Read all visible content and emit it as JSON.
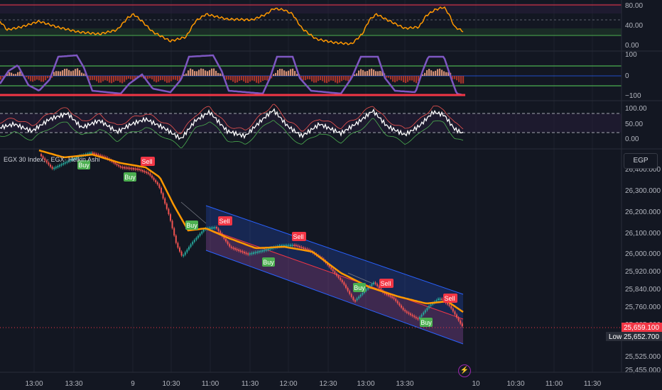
{
  "header": {
    "title": "EGX 30 Index, ",
    "title_tail": "· EGX· Heikin Ashi",
    "currency": "EGP"
  },
  "colors": {
    "background": "#131722",
    "grid": "#1e222d",
    "rsi_line": "#ff9800",
    "osc_line": "#7e57c2",
    "bull": "#26a69a",
    "bear": "#ef5350",
    "buy": "#4caf50",
    "sell": "#f23645",
    "ema": "#ff9800",
    "price_tag": "#f23645",
    "low_tag": "#2a2e39"
  },
  "indicators": {
    "pane1": {
      "ticks": [
        "80.00",
        "40.00",
        "0.00"
      ]
    },
    "pane2": {
      "ticks": [
        "100",
        "0",
        "−100"
      ]
    },
    "pane3": {
      "ticks": [
        "100.00",
        "50.00",
        "0.00"
      ]
    }
  },
  "price_axis": {
    "ticks": [
      "26,400.000",
      "26,300.000",
      "26,200.000",
      "26,100.000",
      "26,000.000",
      "25,920.000",
      "25,840.000",
      "25,760.000",
      "25,685.000",
      "25,525.000",
      "25,455.000"
    ]
  },
  "time_axis": {
    "ticks": [
      "13:00",
      "13:30",
      "9",
      "10:30",
      "11:00",
      "11:30",
      "12:00",
      "12:30",
      "13:00",
      "13:30",
      "10",
      "10:30",
      "11:00",
      "11:30"
    ]
  },
  "price_tags": {
    "last": "25,659.100",
    "low_label": "Low",
    "low_value": "25,652.700"
  },
  "signals": [
    {
      "label": "Buy"
    },
    {
      "label": "Buy"
    },
    {
      "label": "Sell"
    },
    {
      "label": "Buy"
    },
    {
      "label": "Sell"
    },
    {
      "label": "Buy"
    },
    {
      "label": "Sell"
    },
    {
      "label": "Buy"
    },
    {
      "label": "Sell"
    },
    {
      "label": "Buy"
    },
    {
      "label": "Sell"
    }
  ]
}
